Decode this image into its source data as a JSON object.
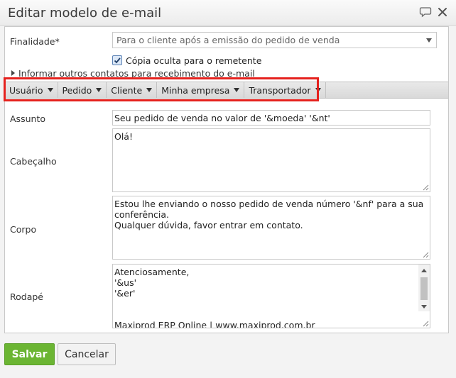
{
  "dialog": {
    "title": "Editar modelo de e-mail",
    "icons": [
      "chat-icon",
      "close-icon"
    ]
  },
  "form": {
    "finalidade": {
      "label": "Finalidade*",
      "value": "Para o cliente após a emissão do pedido de venda"
    },
    "copia_oculta": {
      "label": "Cópia oculta para o remetente",
      "checked": true
    },
    "outros_contatos": {
      "label": "Informar outros contatos para recebimento do e-mail",
      "expanded": false
    },
    "toolbar": {
      "items": [
        "Usuário",
        "Pedido",
        "Cliente",
        "Minha empresa",
        "Transportador"
      ]
    },
    "assunto": {
      "label": "Assunto",
      "value": "Seu pedido de venda no valor de '&moeda' '&nt'"
    },
    "cabecalho": {
      "label": "Cabeçalho",
      "lines": [
        "Olá!"
      ]
    },
    "corpo": {
      "label": "Corpo",
      "lines": [
        "Estou lhe enviando o nosso pedido de venda número '&nf' para a sua",
        "conferência.",
        "Qualquer dúvida, favor entrar em contato."
      ]
    },
    "rodape": {
      "label": "Rodapé",
      "lines": [
        "Atenciosamente,",
        "'&us'",
        "'&er'",
        "",
        "",
        "Maxiprod ERP Online | www.maxiprod.com.br"
      ]
    }
  },
  "actions": {
    "save_label": "Salvar",
    "cancel_label": "Cancelar"
  },
  "colors": {
    "save_button": "#6bb533",
    "highlight_box": "#e5211d"
  }
}
